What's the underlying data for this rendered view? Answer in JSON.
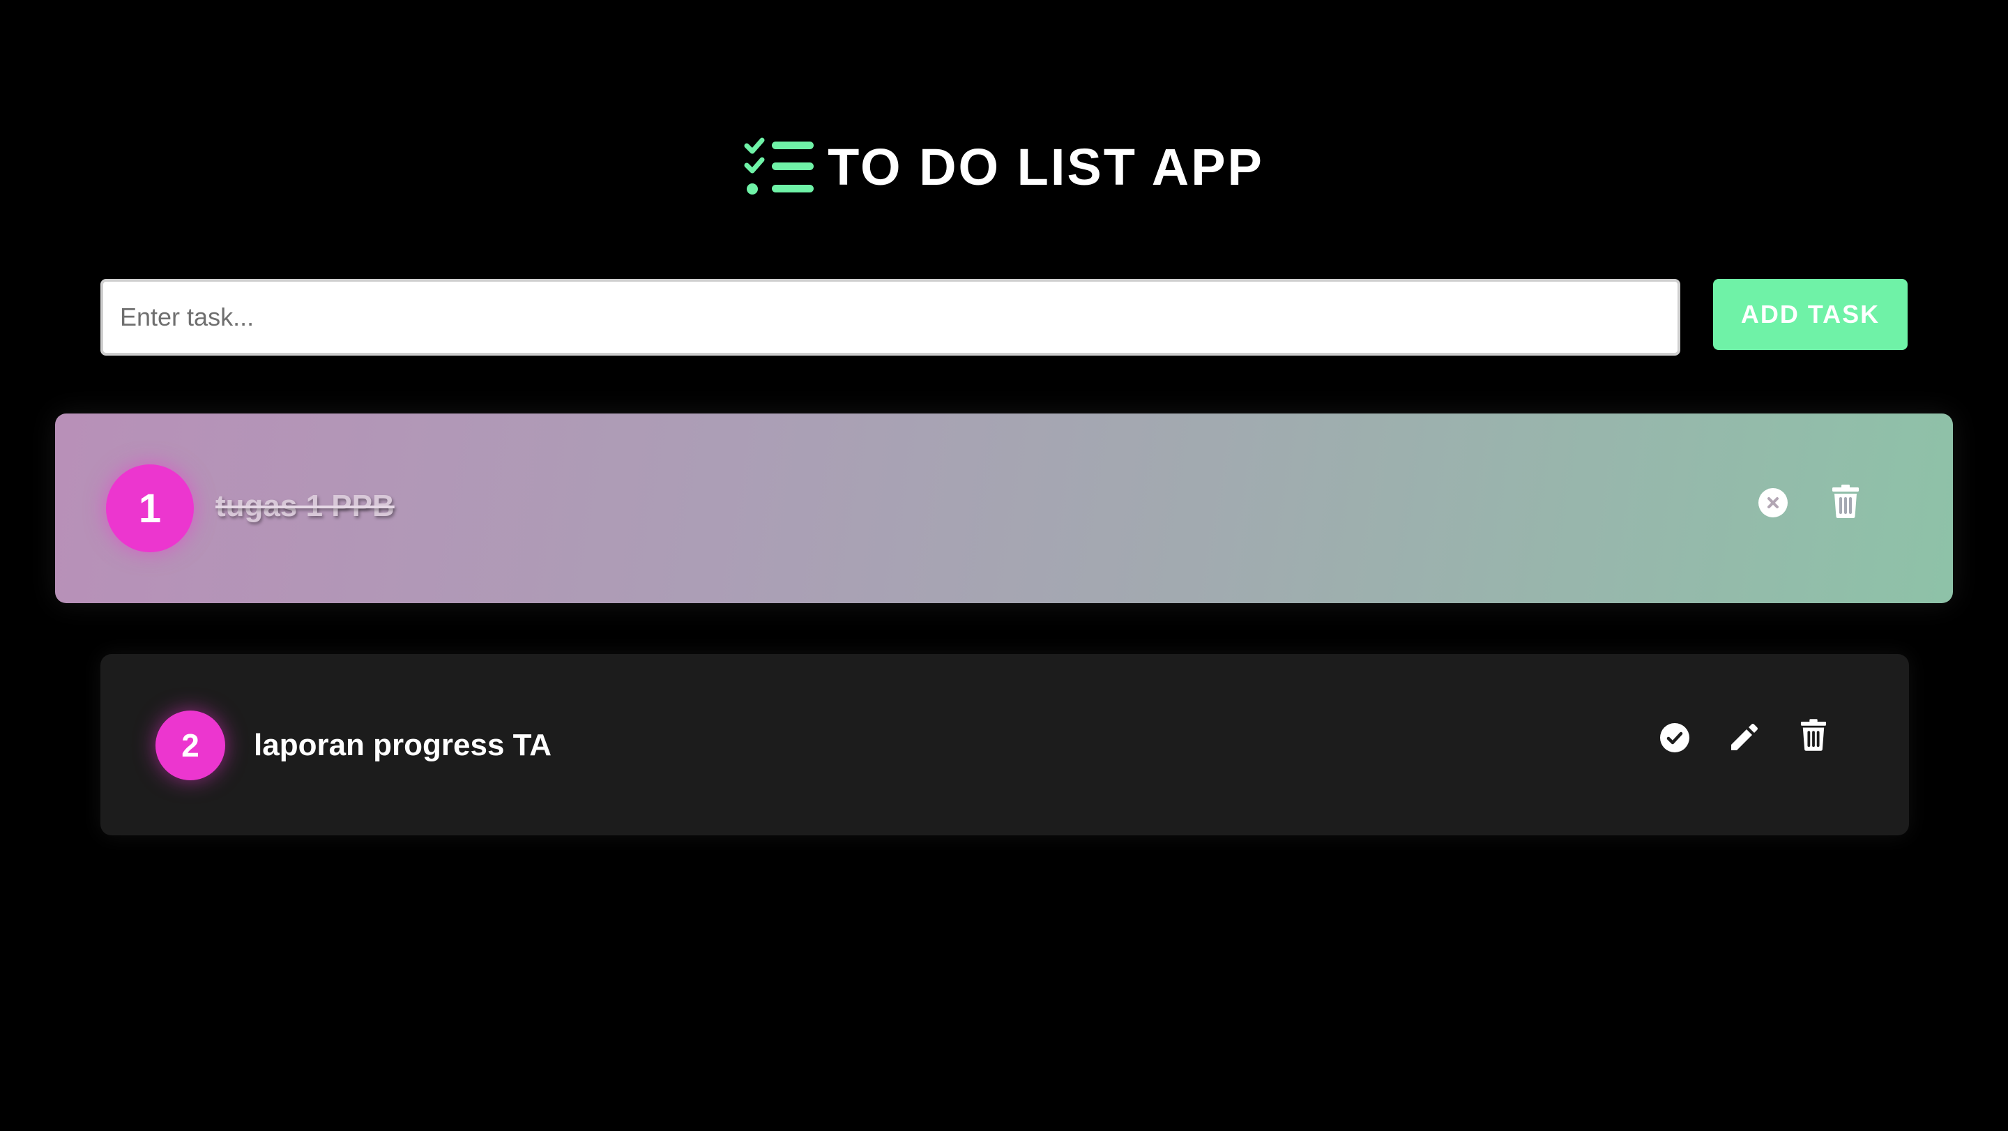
{
  "app": {
    "title": "TO DO LIST APP",
    "logo_icon": "checklist-icon",
    "accent_color": "#6ff2a7",
    "badge_color": "#ec36cf"
  },
  "input": {
    "placeholder": "Enter task...",
    "value": ""
  },
  "add_button": {
    "label": "ADD TASK"
  },
  "tasks": [
    {
      "number": "1",
      "text": "tugas 1 PPB",
      "completed": true,
      "actions": [
        "uncheck-icon",
        "trash-icon"
      ]
    },
    {
      "number": "2",
      "text": "laporan progress TA",
      "completed": false,
      "actions": [
        "check-circle-icon",
        "pencil-icon",
        "trash-icon"
      ]
    }
  ]
}
